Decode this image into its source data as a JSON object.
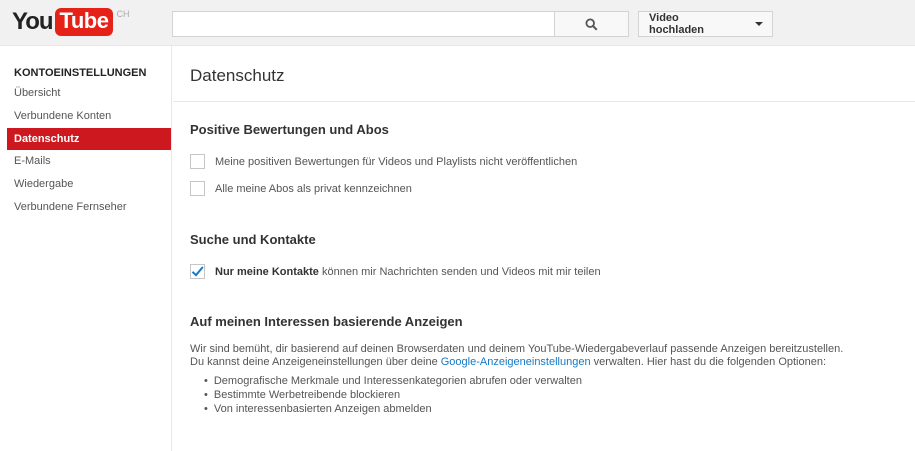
{
  "masthead": {
    "logo_you": "You",
    "logo_tube": "Tube",
    "logo_country": "CH",
    "search_value": "",
    "search_placeholder": "",
    "upload_label": "Video hochladen",
    "icons": {
      "search": "search-icon",
      "menu_caret": "caret-down-icon"
    }
  },
  "sidebar": {
    "heading": "KONTOEINSTELLUNGEN",
    "items": [
      {
        "label": "Übersicht",
        "active": false
      },
      {
        "label": "Verbundene Konten",
        "active": false
      },
      {
        "label": "Datenschutz",
        "active": true
      },
      {
        "label": "E-Mails",
        "active": false
      },
      {
        "label": "Wiedergabe",
        "active": false
      },
      {
        "label": "Verbundene Fernseher",
        "active": false
      }
    ]
  },
  "main": {
    "title": "Datenschutz",
    "sections": {
      "ratings": {
        "heading": "Positive Bewertungen und Abos",
        "options": [
          {
            "label": "Meine positiven Bewertungen für Videos und Playlists nicht veröffentlichen",
            "checked": false
          },
          {
            "label": "Alle meine Abos als privat kennzeichnen",
            "checked": false
          }
        ]
      },
      "search": {
        "heading": "Suche und Kontakte",
        "option": {
          "bold": "Nur meine Kontakte",
          "rest": " können mir Nachrichten senden und Videos mit mir teilen",
          "checked": true
        }
      },
      "ads": {
        "heading": "Auf meinen Interessen basierende Anzeigen",
        "line1": "Wir sind bemüht, dir basierend auf deinen Browserdaten und deinem YouTube-Wiedergabeverlauf passende Anzeigen bereitzustellen.",
        "line2_before": "Du kannst deine Anzeigeneinstellungen über deine ",
        "line2_link": "Google-Anzeigeneinstellungen",
        "line2_after": " verwalten. Hier hast du die folgenden Optionen:",
        "bullets": [
          "Demografische Merkmale und Interessenkategorien abrufen oder verwalten",
          "Bestimmte Werbetreibende blockieren",
          "Von interessenbasierten Anzeigen abmelden"
        ]
      }
    }
  },
  "colors": {
    "brand_red": "#e62117",
    "active_red": "#cc181e",
    "link_blue": "#167ac6",
    "masthead_bg": "#f1f1f1"
  }
}
